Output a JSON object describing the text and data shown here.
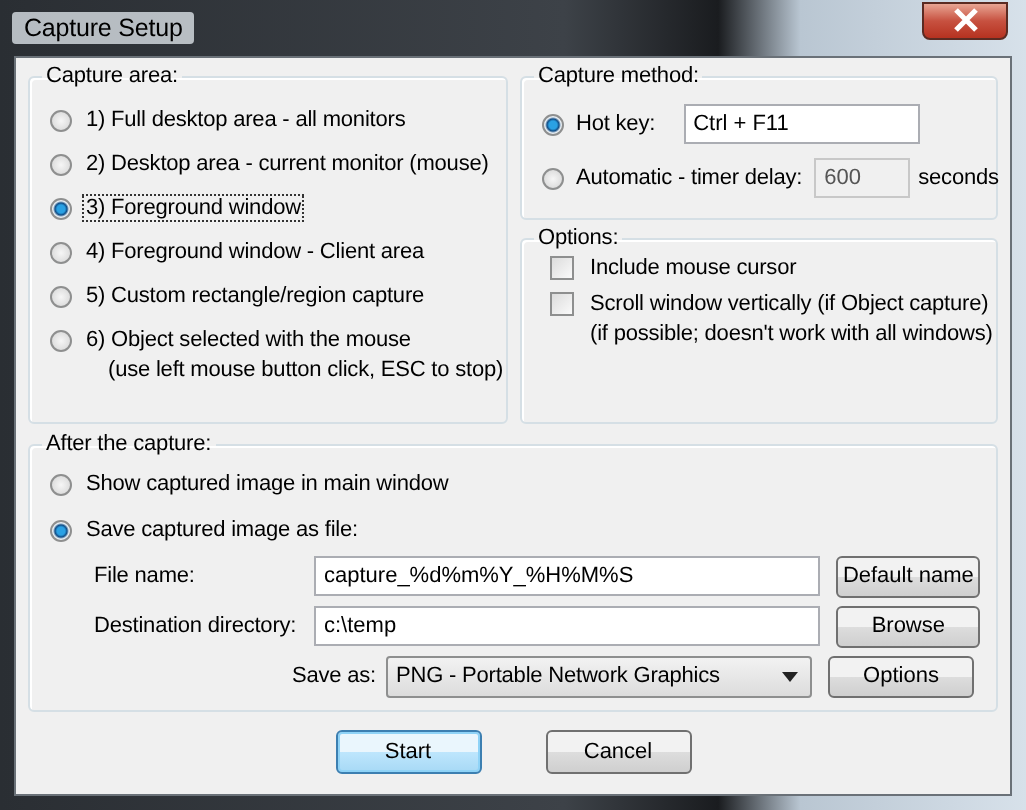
{
  "window": {
    "title": "Capture Setup"
  },
  "capture_area": {
    "label": "Capture area:",
    "options": [
      {
        "label": "1) Full desktop area - all monitors",
        "selected": false
      },
      {
        "label": "2) Desktop area - current monitor (mouse)",
        "selected": false
      },
      {
        "label": "3) Foreground window",
        "selected": true
      },
      {
        "label": "4) Foreground window - Client area",
        "selected": false
      },
      {
        "label": "5) Custom rectangle/region capture",
        "selected": false
      },
      {
        "label": "6) Object selected with the mouse",
        "note": "(use left mouse button click, ESC to stop)",
        "selected": false
      }
    ]
  },
  "capture_method": {
    "label": "Capture method:",
    "options": [
      {
        "kind": "hotkey",
        "label": "Hot key:",
        "value": "Ctrl + F11",
        "disabled": false,
        "selected": true
      },
      {
        "kind": "timer",
        "label": "Automatic - timer delay:",
        "value": "600",
        "unit": "seconds",
        "disabled": true,
        "selected": false
      }
    ]
  },
  "options": {
    "label": "Options:",
    "items": [
      {
        "label": "Include mouse cursor",
        "checked": false
      },
      {
        "label": "Scroll window vertically (if Object capture)",
        "note": "(if possible; doesn't work with all windows)",
        "checked": false
      }
    ]
  },
  "after_capture": {
    "label": "After the capture:",
    "options": [
      {
        "label": "Show captured image in main window",
        "selected": false
      },
      {
        "label": "Save captured image as file:",
        "selected": true
      }
    ],
    "fields": [
      {
        "kind": "text",
        "label": "File name:",
        "value": "capture_%d%m%Y_%H%M%S",
        "button": "Default name"
      },
      {
        "kind": "text",
        "label": "Destination directory:",
        "value": "c:\\temp",
        "button": "Browse"
      },
      {
        "kind": "select",
        "label": "Save as:",
        "value": "PNG - Portable Network Graphics",
        "button": "Options"
      }
    ]
  },
  "buttons": [
    {
      "label": "Start",
      "default": true
    },
    {
      "label": "Cancel",
      "default": false
    }
  ]
}
